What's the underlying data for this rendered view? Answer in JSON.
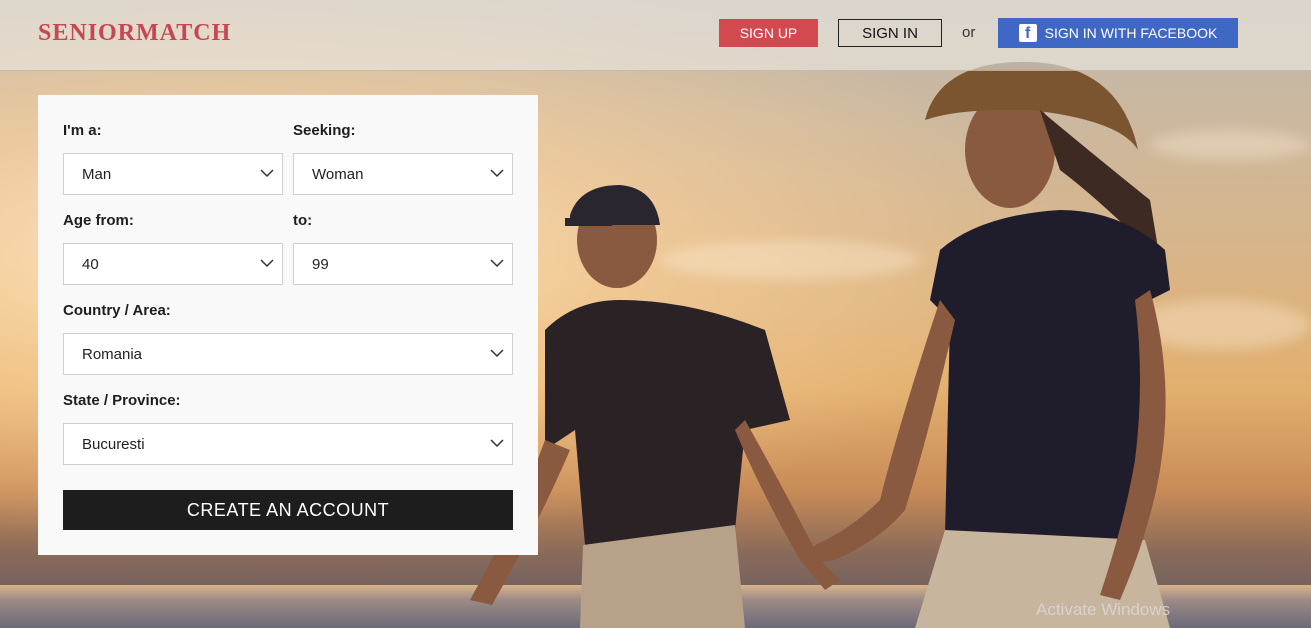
{
  "header": {
    "logo": "SENIORMATCH",
    "signup_label": "SIGN UP",
    "signin_label": "SIGN IN",
    "or_text": "or",
    "facebook_label": "SIGN IN WITH FACEBOOK",
    "facebook_icon": "f"
  },
  "form": {
    "iam_label": "I'm a:",
    "iam_value": "Man",
    "seeking_label": "Seeking:",
    "seeking_value": "Woman",
    "age_from_label": "Age from:",
    "age_from_value": "40",
    "age_to_label": "to:",
    "age_to_value": "99",
    "country_label": "Country / Area:",
    "country_value": "Romania",
    "state_label": "State / Province:",
    "state_value": "Bucuresti",
    "submit_label": "CREATE AN ACCOUNT"
  },
  "system": {
    "watermark": "Activate Windows"
  },
  "colors": {
    "brand": "#c7464f",
    "signup": "#d24a4f",
    "facebook": "#3f68c4",
    "submit": "#1d1d1d"
  },
  "icons": [
    "facebook-icon",
    "chevron-down-icon"
  ]
}
